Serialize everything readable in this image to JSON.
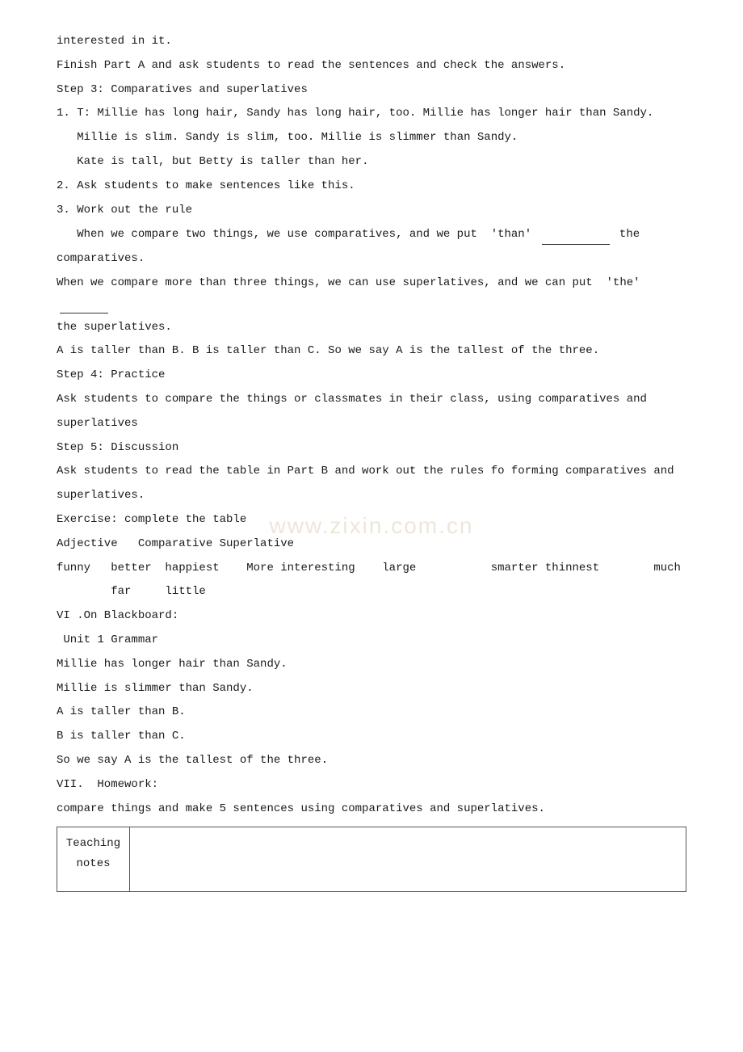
{
  "watermark": "www.zixin.com.cn",
  "content": {
    "line1": "interested in it.",
    "line2": "Finish Part A and ask students to read the sentences and check the answers.",
    "line3": "Step 3: Comparatives and superlatives",
    "line4": "1. T: Millie has long hair, Sandy has long hair, too. Millie has longer hair than Sandy.",
    "line5": "   Millie is slim. Sandy is slim, too. Millie is slimmer than Sandy.",
    "line6": "   Kate is tall, but Betty is taller than her.",
    "line7": "2. Ask students to make sentences like this.",
    "line8": "3. Work out the rule",
    "line9_part1": "   When we compare two things, we use comparatives, and we put  ‘than’",
    "line9_part2": "the",
    "line9_part3": "comparatives.",
    "line10_part1": "When we compare more than three things, we can use superlatives, and we can put  ‘the’",
    "line10_part2": "the superlatives.",
    "line11": "A is taller than B. B is taller than C. So we say A is the tallest of the three.",
    "line12": "Step 4: Practice",
    "line13": "Ask students to compare the things or classmates in their class, using comparatives and",
    "line14": "superlatives",
    "line15": "Step 5: Discussion",
    "line16": "Ask students to read the table in Part B and work out the rules fo forming comparatives and",
    "line17": "superlatives.",
    "line18": "Exercise: complete the table",
    "line19": "Adjective   Comparative Superlative",
    "line20": "funny   better  happiest    More interesting    large           smarter thinnest        much",
    "line21": "        far     little",
    "line22": "VI .On Blackboard:",
    "line23": " Unit 1 Grammar",
    "line24": "Millie has longer hair than Sandy.",
    "line25": "Millie is slimmer than Sandy.",
    "line26": "A is taller than B.",
    "line27": "B is taller than C.",
    "line28": "So we say A is the tallest of the three.",
    "line29": "VII.  Homework:",
    "line30": "compare things and make 5 sentences using comparatives and superlatives.",
    "table": {
      "label_line1": "Teaching",
      "label_line2": "notes",
      "content": ""
    }
  }
}
